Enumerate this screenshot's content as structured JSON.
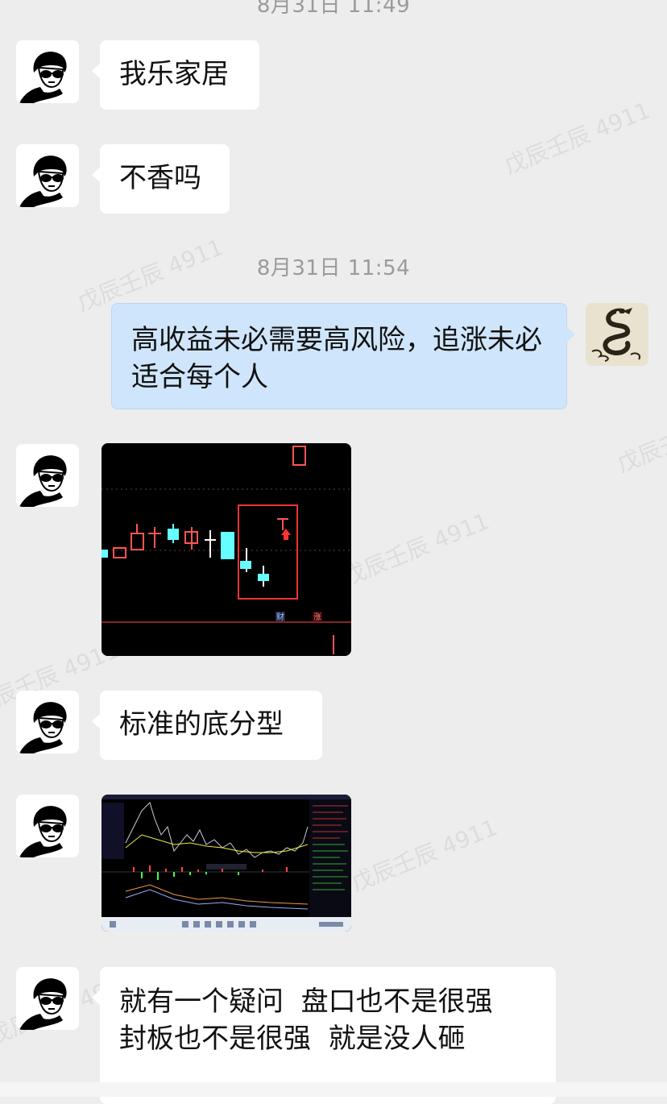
{
  "timestamps": [
    "8月31日 11:49",
    "8月31日 11:54"
  ],
  "watermark": "戊辰壬辰 4911",
  "messages": {
    "m1": "我乐家居",
    "m2": "不香吗",
    "m3": "高收益未必需要高风险，追涨未必适合每个人",
    "m5": "标准的底分型",
    "m7": "就有一个疑问  盘口也不是很强  封板也不是很强  就是没人砸"
  },
  "chart_labels": {
    "cai": "财",
    "zhang": "涨"
  },
  "colors": {
    "background": "#ededed",
    "my_bubble": "#cfe5fb",
    "their_bubble": "#ffffff",
    "timestamp": "#9a9a9a"
  },
  "icons": {
    "sender_avatar": "sunglasses-man-avatar-icon",
    "my_avatar": "dragon-avatar-icon"
  }
}
